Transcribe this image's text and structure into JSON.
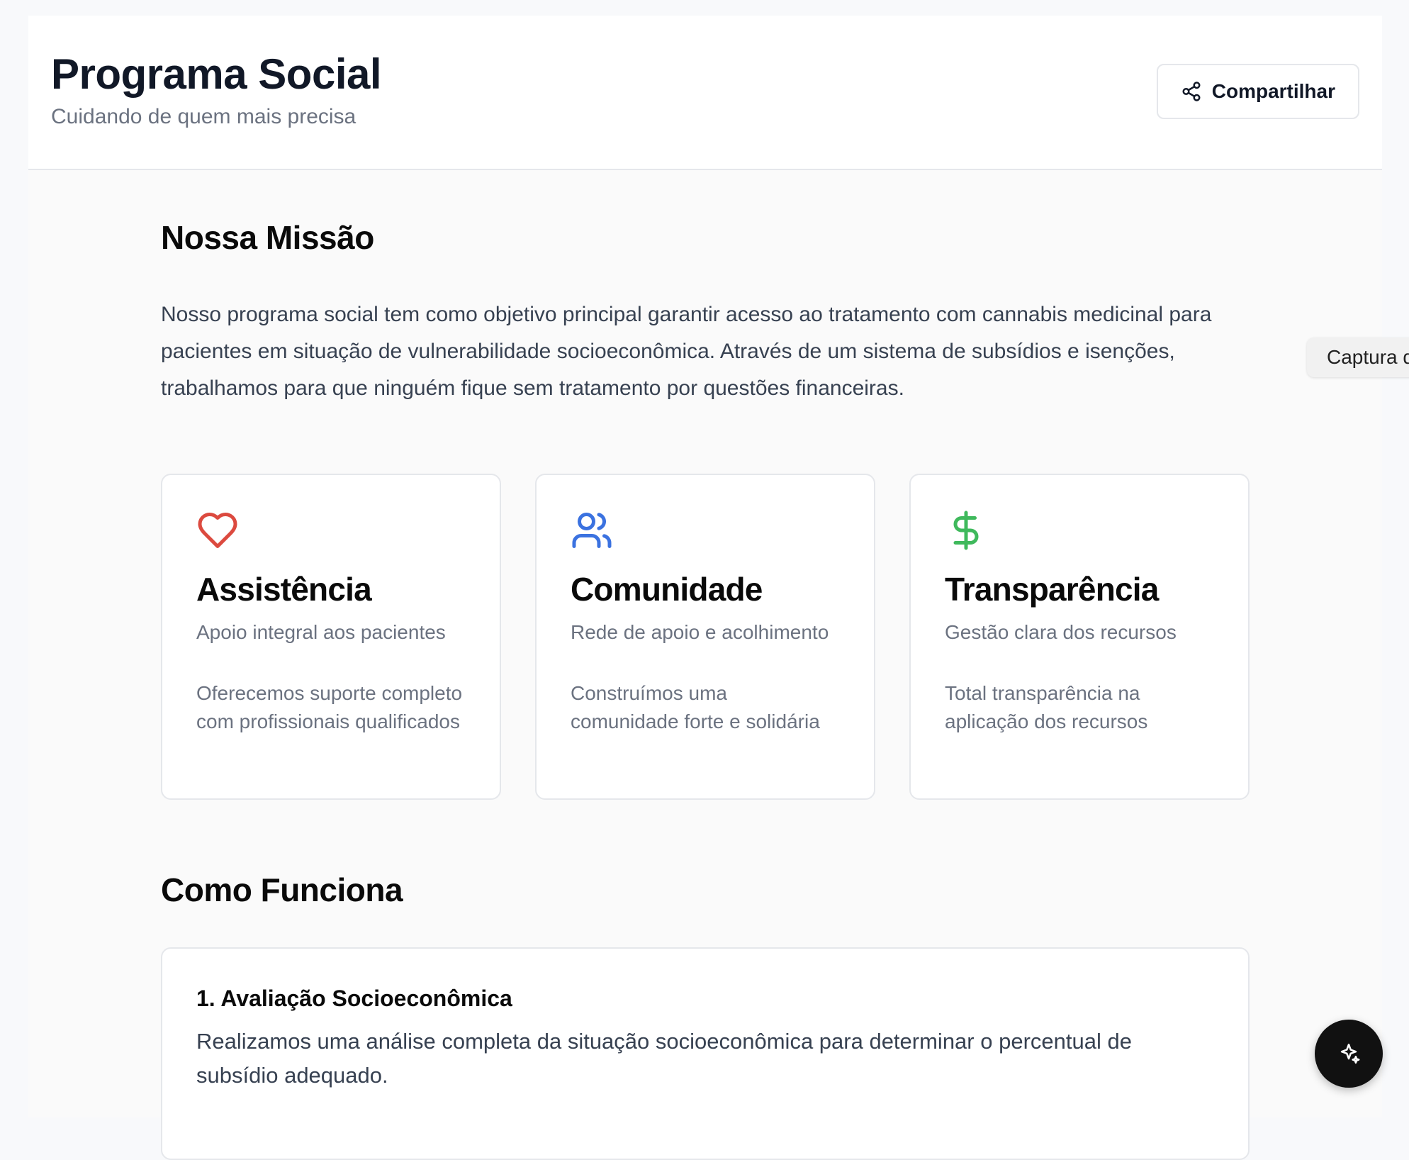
{
  "header": {
    "title": "Programa Social",
    "subtitle": "Cuidando de quem mais precisa",
    "share_label": "Compartilhar"
  },
  "mission": {
    "title": "Nossa Missão",
    "text": "Nosso programa social tem como objetivo principal garantir acesso ao tratamento com cannabis medicinal para pacientes em situação de vulnerabilidade socioeconômica. Através de um sistema de subsídios e isenções, trabalhamos para que ninguém fique sem tratamento por questões financeiras."
  },
  "cards": [
    {
      "icon": "heart-icon",
      "icon_color": "#dc4a3f",
      "title": "Assistência",
      "subtitle": "Apoio integral aos pacientes",
      "description": "Oferecemos suporte completo com profissionais qualificados"
    },
    {
      "icon": "users-icon",
      "icon_color": "#3b72e0",
      "title": "Comunidade",
      "subtitle": "Rede de apoio e acolhimento",
      "description": "Construímos uma comunidade forte e solidária"
    },
    {
      "icon": "dollar-icon",
      "icon_color": "#3fb95c",
      "title": "Transparência",
      "subtitle": "Gestão clara dos recursos",
      "description": "Total transparência na aplicação dos recursos"
    }
  ],
  "how_it_works": {
    "title": "Como Funciona",
    "steps": [
      {
        "title": "1. Avaliação Socioeconômica",
        "description": "Realizamos uma análise completa da situação socioeconômica para determinar o percentual de subsídio adequado."
      }
    ]
  },
  "overlay": {
    "capture_label": "Captura de"
  }
}
